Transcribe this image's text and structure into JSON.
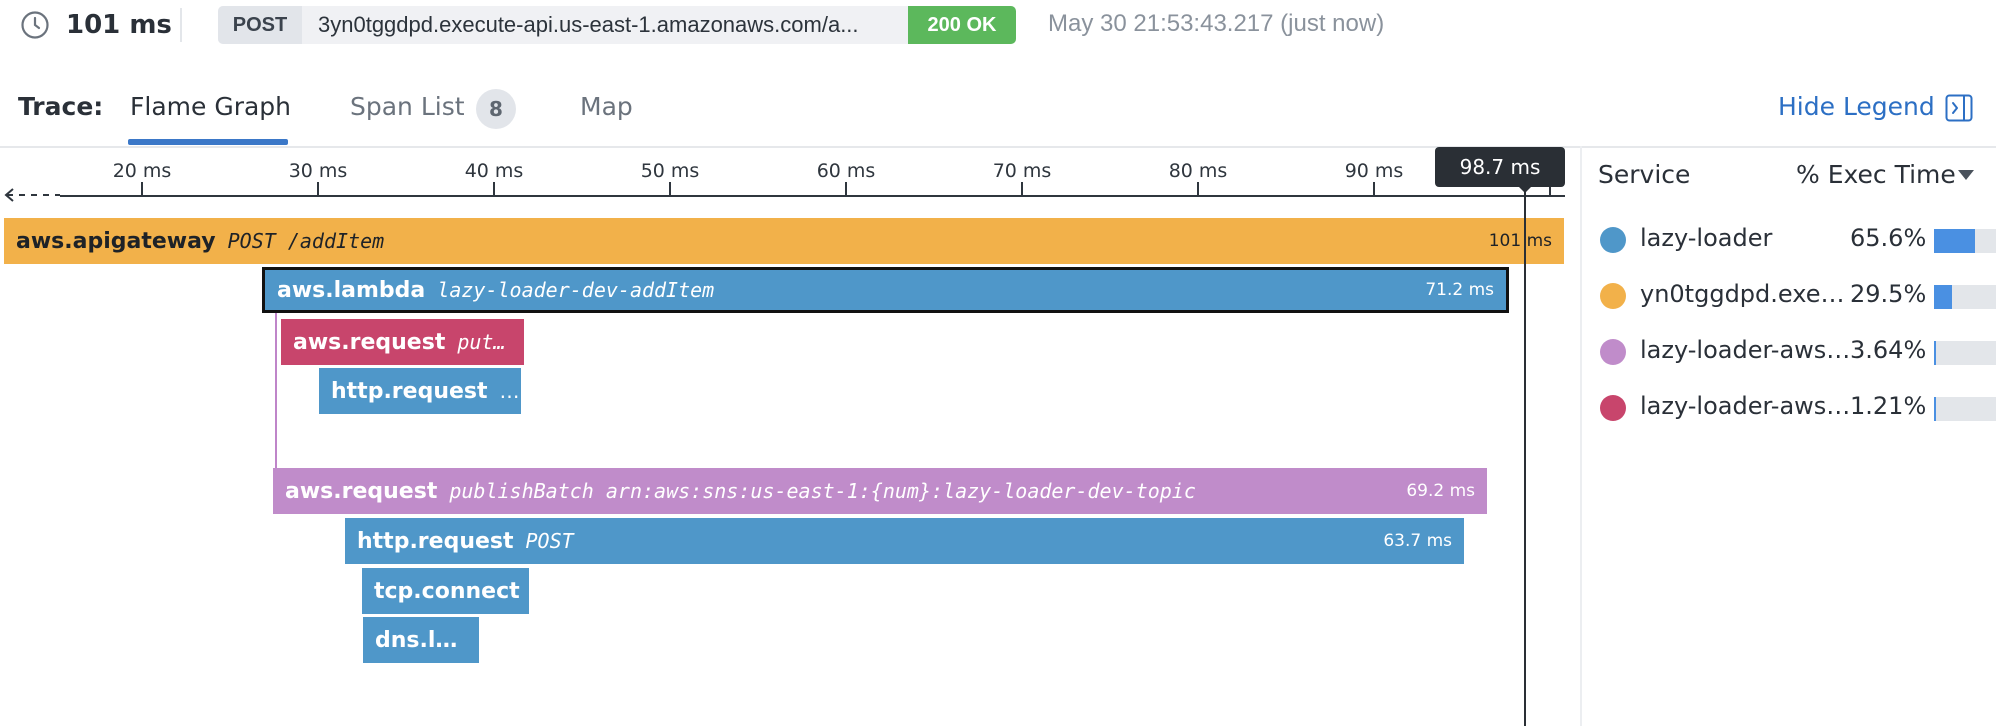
{
  "header": {
    "duration": "101 ms",
    "request": {
      "method": "POST",
      "url": "3yn0tggdpd.execute-api.us-east-1.amazonaws.com/a...",
      "status": "200 OK"
    },
    "timestamp": "May 30 21:53:43.217 (just now)"
  },
  "tabs": {
    "trace_label": "Trace:",
    "items": [
      {
        "label": "Flame Graph",
        "active": true
      },
      {
        "label": "Span List",
        "count": "8"
      },
      {
        "label": "Map"
      }
    ],
    "hide_legend": "Hide Legend"
  },
  "timeline": {
    "ticks": [
      "20 ms",
      "30 ms",
      "40 ms",
      "50 ms",
      "60 ms",
      "70 ms",
      "80 ms",
      "90 ms"
    ],
    "cursor_label": "98.7 ms"
  },
  "spans": [
    {
      "service": "aws.apigateway",
      "resource": "POST /addItem",
      "duration": "101 ms",
      "color": "#f2b14a"
    },
    {
      "service": "aws.lambda",
      "resource": "lazy-loader-dev-addItem",
      "duration": "71.2 ms",
      "color": "#4f97c9",
      "selected": true
    },
    {
      "service": "aws.request",
      "resource": "put…",
      "duration": "",
      "color": "#c8456c"
    },
    {
      "service": "http.request",
      "resource": "…",
      "duration": "",
      "color": "#4f97c9"
    },
    {
      "service": "aws.request",
      "resource": "publishBatch arn:aws:sns:us-east-1:{num}:lazy-loader-dev-topic",
      "duration": "69.2 ms",
      "color": "#c08cca"
    },
    {
      "service": "http.request",
      "resource": "POST",
      "duration": "63.7 ms",
      "color": "#4f97c9"
    },
    {
      "service": "tcp.connect",
      "resource": "",
      "duration": "",
      "color": "#4f97c9"
    },
    {
      "service": "dns.l…",
      "resource": "",
      "duration": "",
      "color": "#4f97c9"
    }
  ],
  "legend": {
    "header_service": "Service",
    "header_exec": "% Exec Time",
    "items": [
      {
        "name": "lazy-loader",
        "pct": "65.6%",
        "fraction": 0.656,
        "color": "#4f97c9"
      },
      {
        "name": "yn0tggdpd.exe…",
        "pct": "29.5%",
        "fraction": 0.295,
        "color": "#f2b14a"
      },
      {
        "name": "lazy-loader-aws…",
        "pct": "3.64%",
        "fraction": 0.0364,
        "color": "#c08cca"
      },
      {
        "name": "lazy-loader-aws…",
        "pct": "1.21%",
        "fraction": 0.0121,
        "color": "#c8456c"
      }
    ]
  }
}
